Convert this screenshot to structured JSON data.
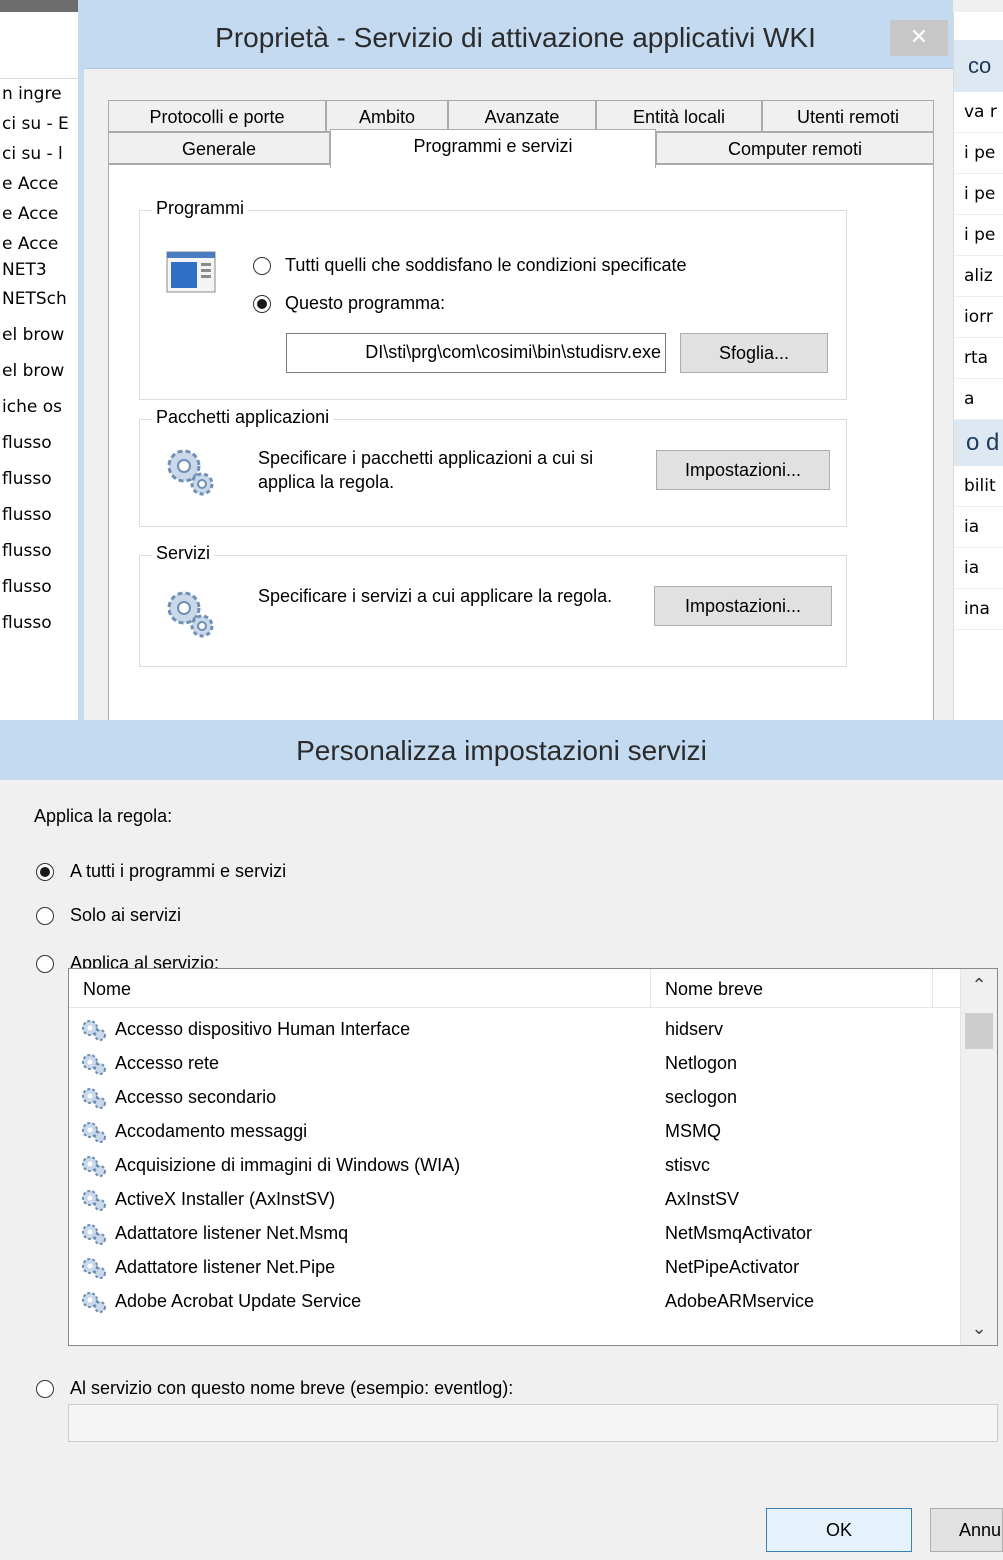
{
  "background": {
    "left_rows": [
      "n ingre",
      "ci su - E",
      "ci su - l",
      "e Acce",
      "e Acce",
      "e Acce",
      "NET3",
      "NETSch",
      "el brow",
      "el brow",
      "iche os",
      "flusso",
      "flusso",
      "flusso",
      "flusso",
      "flusso",
      "flusso"
    ],
    "right_header": "co",
    "right_rows": [
      "va r",
      "i pe",
      "i pe",
      "i pe",
      "aliz",
      "iorr",
      "rta",
      "a"
    ],
    "right_header2": "o d",
    "right_rows2": [
      "bilit",
      "ia",
      "ia",
      "ina"
    ]
  },
  "props_dialog": {
    "title": "Proprietà - Servizio di attivazione applicativi WKI",
    "close": "✕",
    "tabs_row1": [
      "Protocolli e porte",
      "Ambito",
      "Avanzate",
      "Entità locali",
      "Utenti remoti"
    ],
    "tabs_row2": [
      "Generale",
      "Programmi e servizi",
      "Computer remoti"
    ],
    "programs": {
      "group": "Programmi",
      "option_all": "Tutti quelli che soddisfano le condizioni specificate",
      "option_this": "Questo programma:",
      "path": "DI\\sti\\prg\\com\\cosimi\\bin\\studisrv.exe",
      "browse": "Sfoglia..."
    },
    "packages": {
      "group": "Pacchetti applicazioni",
      "text": "Specificare i pacchetti applicazioni a cui si applica la regola.",
      "button": "Impostazioni..."
    },
    "services": {
      "group": "Servizi",
      "text": "Specificare i servizi a cui applicare la regola.",
      "button": "Impostazioni..."
    }
  },
  "services_dialog": {
    "title": "Personalizza impostazioni servizi",
    "apply_label": "Applica la regola:",
    "options": [
      "A tutti i programmi e servizi",
      "Solo ai servizi",
      "Applica al servizio:"
    ],
    "list": {
      "col_name": "Nome",
      "col_short": "Nome breve",
      "rows": [
        {
          "name": "Accesso dispositivo Human Interface",
          "short": "hidserv"
        },
        {
          "name": "Accesso rete",
          "short": "Netlogon"
        },
        {
          "name": "Accesso secondario",
          "short": "seclogon"
        },
        {
          "name": "Accodamento messaggi",
          "short": "MSMQ"
        },
        {
          "name": "Acquisizione di immagini di Windows (WIA)",
          "short": "stisvc"
        },
        {
          "name": "ActiveX Installer (AxInstSV)",
          "short": "AxInstSV"
        },
        {
          "name": "Adattatore listener Net.Msmq",
          "short": "NetMsmqActivator"
        },
        {
          "name": "Adattatore listener Net.Pipe",
          "short": "NetPipeActivator"
        },
        {
          "name": "Adobe Acrobat Update Service",
          "short": "AdobeARMservice"
        }
      ]
    },
    "short_name_option": "Al servizio con questo nome breve (esempio: eventlog):",
    "short_name_value": "",
    "ok": "OK",
    "cancel": "Annu"
  }
}
